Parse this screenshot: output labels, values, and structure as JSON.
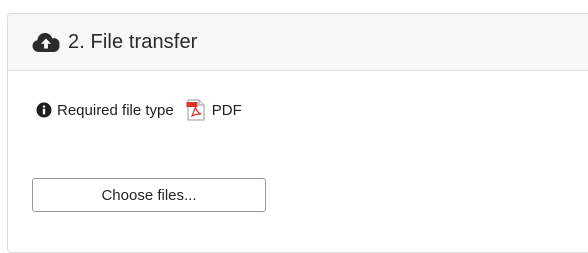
{
  "panel": {
    "title": "2. File transfer",
    "header_icon": "cloud-upload-icon"
  },
  "requirement": {
    "info_icon": "info-circle-icon",
    "label": "Required file type",
    "file_type_icon": "pdf-file-icon",
    "file_type": "PDF"
  },
  "upload": {
    "button_label": "Choose files..."
  },
  "colors": {
    "header_bg": "#f7f7f7",
    "border": "#dcdcdc",
    "pdf_red": "#d9362b"
  }
}
